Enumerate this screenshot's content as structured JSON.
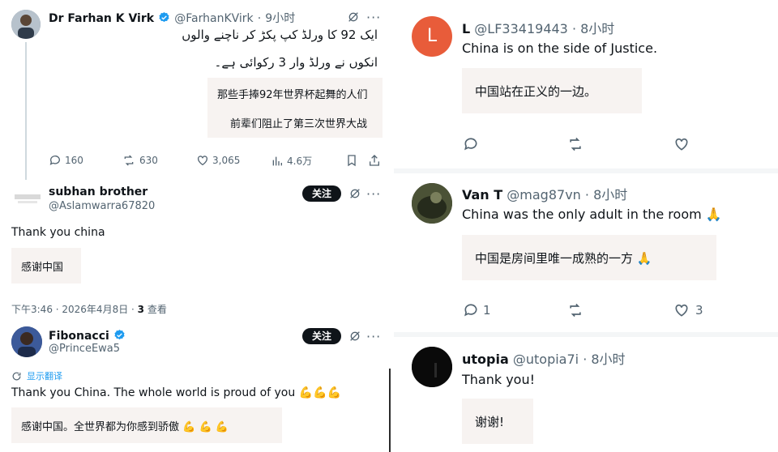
{
  "left": {
    "tweet1": {
      "name": "Dr Farhan K Virk",
      "handle": "@FarhanKVirk",
      "dot": "·",
      "time": "9小时",
      "urdu_line1": "ایک 92 کا ورلڈ کپ پکڑ کر ناچنے والوں",
      "urdu_line2": "انکوں نے ورلڈ وار 3 رکوائی ہے۔",
      "translation_line1": "那些手捧92年世界杯起舞的人们",
      "translation_line2": "前辈们阻止了第三次世界大战",
      "stats": {
        "replies": "160",
        "reposts": "630",
        "likes": "3,065",
        "views": "4.6万"
      }
    },
    "tweet2": {
      "name": "subhan brother",
      "handle": "@Aslamwarra67820",
      "follow": "关注",
      "text": "Thank you china",
      "translation": "感谢中国"
    },
    "meta_row": {
      "timestamp": "下午3:46 · 2026年4月8日 · ",
      "views_count": "3",
      "views_label": " 查看"
    },
    "tweet3": {
      "name": "Fibonacci",
      "handle": "@PrinceEwa5",
      "follow": "关注",
      "show_translation": "显示翻译",
      "text": "Thank you China. The whole world is proud of you 💪💪💪",
      "translation": "感谢中国。全世界都为你感到骄傲 💪 💪 💪"
    }
  },
  "right": {
    "reply1": {
      "name": "L",
      "handle": "@LF33419443",
      "time": "· 8小时",
      "avatar_letter": "L",
      "text": "China is on the side of Justice.",
      "translation": "中国站在正义的一边。"
    },
    "reply2": {
      "name": "Van T",
      "handle": "@mag87vn",
      "time": "· 8小时",
      "text": "China was the only adult in the room 🙏",
      "translation": "中国是房间里唯一成熟的一方 🙏",
      "replies": "1",
      "likes": "3"
    },
    "reply3": {
      "name": "utopia",
      "handle": "@utopia7i",
      "time": "· 8小时",
      "text": "Thank you!",
      "translation": "谢谢!"
    }
  },
  "colors": {
    "verified": "#1d9bf0",
    "translation_bg": "#f7f3f1",
    "avatar_L": "#e85c3a",
    "muted": "#536471"
  }
}
